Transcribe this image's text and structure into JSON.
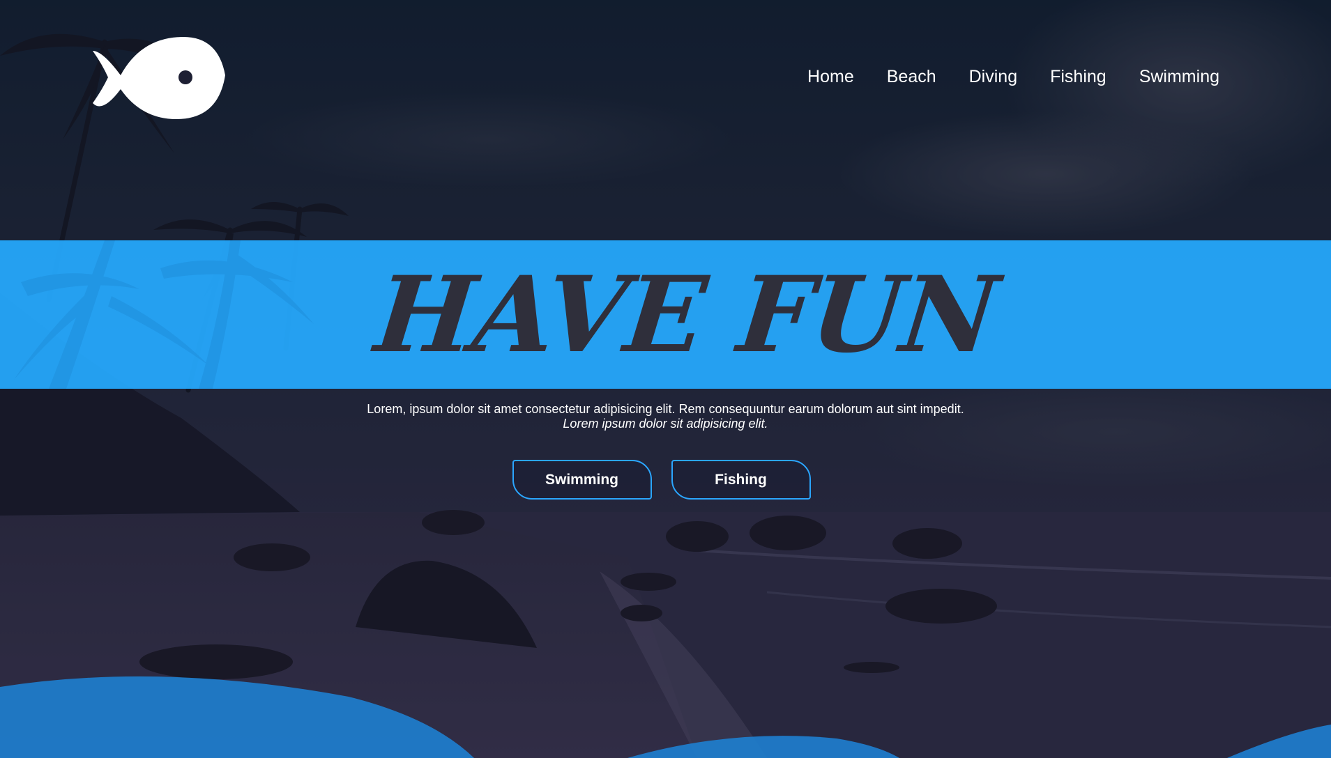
{
  "logo": {
    "icon": "fish-icon"
  },
  "nav": {
    "items": [
      {
        "label": "Home"
      },
      {
        "label": "Beach"
      },
      {
        "label": "Diving"
      },
      {
        "label": "Fishing"
      },
      {
        "label": "Swimming"
      }
    ]
  },
  "hero": {
    "headline": "HAVE FUN",
    "text": "Lorem, ipsum dolor sit amet consectetur adipisicing elit. Rem consequuntur earum dolorum aut sint impedit.",
    "subtext": "Lorem ipsum dolor sit adipisicing elit.",
    "buttons": [
      {
        "label": "Swimming"
      },
      {
        "label": "Fishing"
      }
    ]
  },
  "colors": {
    "accent": "#26aaff",
    "headline": "#2f2f3b",
    "overlay": "#1d1f33",
    "wave": "#1e7fd0"
  }
}
